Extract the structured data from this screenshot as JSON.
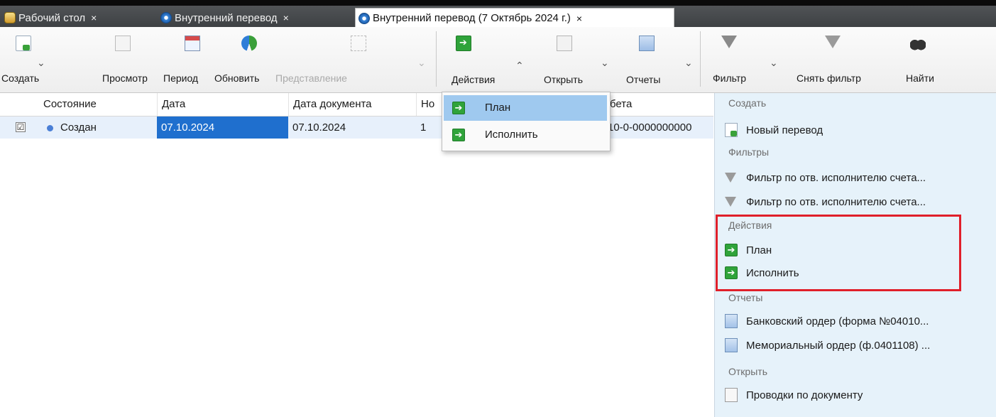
{
  "tabs": [
    {
      "label": "Рабочий стол",
      "icon": "desktop-icon",
      "close": "×"
    },
    {
      "label": "Внутренний перевод",
      "icon": "document-icon",
      "close": "×"
    },
    {
      "label": "Внутренний перевод (7 Октябрь 2024 г.)",
      "icon": "document-icon",
      "close": "×"
    }
  ],
  "toolbar": {
    "create": "Создать",
    "view": "Просмотр",
    "period": "Период",
    "refresh": "Обновить",
    "representation": "Представление",
    "actions": "Действия",
    "open": "Открыть",
    "reports": "Отчеты",
    "filter": "Фильтр",
    "clear_filter": "Снять фильтр",
    "find": "Найти",
    "arrow_down": "⌄",
    "arrow_up": "⌃"
  },
  "grid": {
    "columns": [
      "Состояние",
      "Дата",
      "Дата документа",
      "Но",
      "бета"
    ],
    "rows": [
      {
        "checked": "☑",
        "status": "Создан",
        "date": "07.10.2024",
        "doc_date": "07.10.2024",
        "number": "1",
        "debit": "10-0-0000000000"
      }
    ]
  },
  "actions_menu": {
    "items": [
      {
        "label": "План",
        "icon": "green-arrow-icon",
        "highlighted": true
      },
      {
        "label": "Исполнить",
        "icon": "green-arrow-icon",
        "highlighted": false
      }
    ]
  },
  "side_panel": {
    "create_header": "Создать",
    "new_transfer": "Новый перевод",
    "filters_header": "Фильтры",
    "filter_1": "Фильтр по отв. исполнителю счета...",
    "filter_2": "Фильтр по отв. исполнителю счета...",
    "actions_header": "Действия",
    "action_plan": "План",
    "action_execute": "Исполнить",
    "reports_header": "Отчеты",
    "report_1": "Банковский ордер (форма №04010...",
    "report_2": "Мемориальный ордер (ф.0401108) ...",
    "open_header": "Открыть",
    "open_1": "Проводки по документу"
  },
  "colors": {
    "highlight_box": "#e0202a",
    "selection": "#1f6fce",
    "menu_highlight": "#9fc9ef",
    "panel_bg": "#e6f2fa"
  }
}
